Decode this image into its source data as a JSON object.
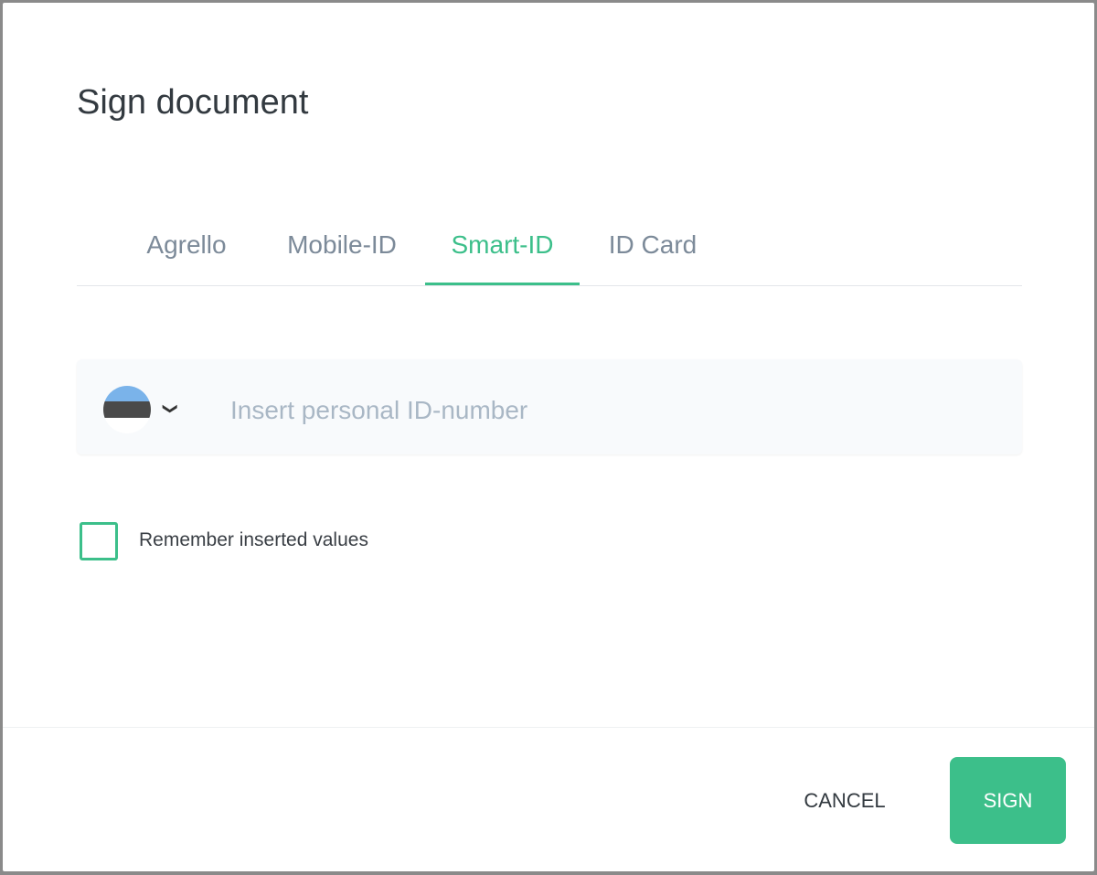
{
  "dialog": {
    "title": "Sign document"
  },
  "tabs": [
    {
      "label": "Agrello",
      "active": false
    },
    {
      "label": "Mobile-ID",
      "active": false
    },
    {
      "label": "Smart-ID",
      "active": true
    },
    {
      "label": "ID Card",
      "active": false
    }
  ],
  "id_field": {
    "country": "Estonia",
    "flag_colors": [
      "#7ab3ea",
      "#4a4a4a",
      "#ffffff"
    ],
    "value": "",
    "placeholder": "Insert personal ID-number"
  },
  "remember": {
    "label": "Remember inserted values",
    "checked": false
  },
  "buttons": {
    "cancel": "CANCEL",
    "sign": "SIGN"
  },
  "colors": {
    "accent": "#3cbf8a"
  }
}
